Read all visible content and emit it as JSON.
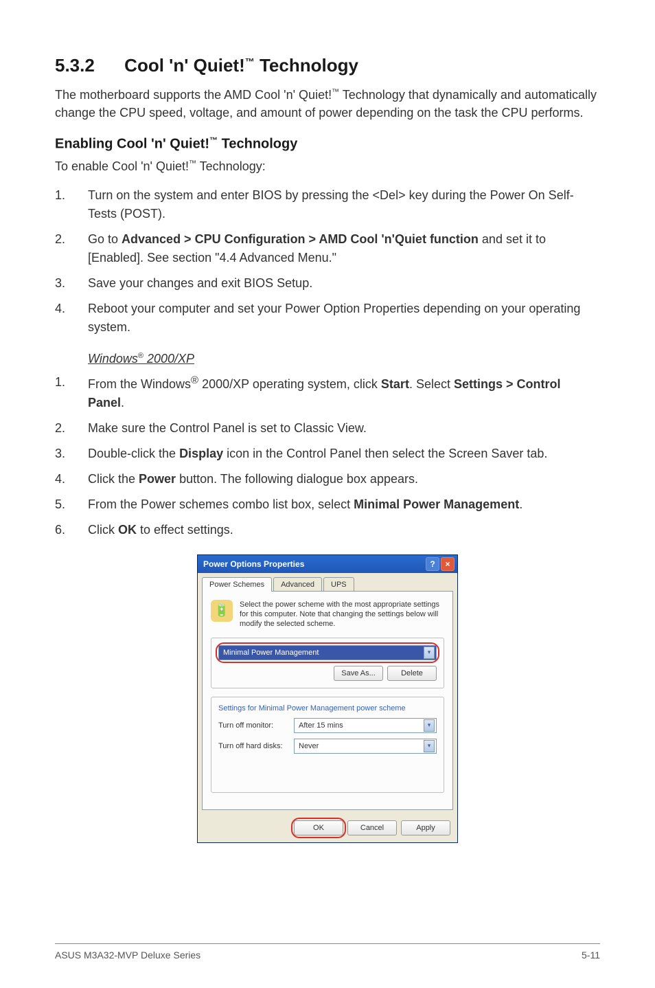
{
  "section": {
    "number": "5.3.2",
    "title_prefix": "Cool 'n' Quiet!",
    "trademark": "™",
    "title_suffix": " Technology"
  },
  "intro": {
    "p1_a": "The motherboard supports the AMD Cool 'n' Quiet!",
    "tm": "™",
    "p1_b": " Technology that dynamically and automatically change the CPU speed, voltage, and amount of power depending on the task the CPU performs."
  },
  "subhead": {
    "prefix": "Enabling Cool 'n' Quiet!",
    "tm": "™",
    "suffix": " Technology"
  },
  "subintro": {
    "a": "To enable Cool 'n' Quiet!",
    "tm": "™",
    "b": " Technology:"
  },
  "steps1": [
    {
      "n": "1.",
      "t": "Turn on the system and enter BIOS by pressing the <Del> key during the Power On Self-Tests (POST)."
    },
    {
      "n": "2.",
      "t_a": "Go to ",
      "t_bold": "Advanced > CPU Configuration > AMD Cool 'n'Quiet function",
      "t_b": " and set it to [Enabled]. See section \"4.4 Advanced Menu.\""
    },
    {
      "n": "3.",
      "t": "Save your changes and exit BIOS Setup."
    },
    {
      "n": "4.",
      "t": "Reboot your computer and set your Power Option Properties depending on your operating system."
    }
  ],
  "windows_heading": {
    "a": "Windows",
    "reg": "®",
    "b": " 2000/XP"
  },
  "steps2": [
    {
      "n": "1.",
      "t_a": "From the Windows",
      "t_sup": "®",
      "t_b": " 2000/XP operating system, click ",
      "t_bold1": "Start",
      "t_c": ". Select ",
      "t_bold2": "Settings > Control Panel",
      "t_d": "."
    },
    {
      "n": "2.",
      "t": "Make sure the Control Panel is set to Classic View."
    },
    {
      "n": "3.",
      "t_a": "Double-click the ",
      "t_bold": "Display",
      "t_b": " icon in the Control Panel then select the Screen Saver tab."
    },
    {
      "n": "4.",
      "t_a": "Click the ",
      "t_bold": "Power",
      "t_b": " button. The following dialogue box appears."
    },
    {
      "n": "5.",
      "t_a": "From the Power schemes combo list box, select ",
      "t_bold": "Minimal Power Management",
      "t_b": "."
    },
    {
      "n": "6.",
      "t_a": "Click ",
      "t_bold": "OK",
      "t_b": " to effect settings."
    }
  ],
  "dialog": {
    "title": "Power Options Properties",
    "help_glyph": "?",
    "close_glyph": "×",
    "tabs": [
      "Power Schemes",
      "Advanced",
      "UPS"
    ],
    "info_text": "Select the power scheme with the most appropriate settings for this computer. Note that changing the settings below will modify the selected scheme.",
    "scheme_selected": "Minimal Power Management",
    "save_as": "Save As...",
    "delete": "Delete",
    "settings_title": "Settings for Minimal Power Management power scheme",
    "row1_label": "Turn off monitor:",
    "row1_value": "After 15 mins",
    "row2_label": "Turn off hard disks:",
    "row2_value": "Never",
    "ok": "OK",
    "cancel": "Cancel",
    "apply": "Apply",
    "chevron": "▾"
  },
  "footer": {
    "left": "ASUS M3A32-MVP Deluxe Series",
    "right": "5-11"
  }
}
